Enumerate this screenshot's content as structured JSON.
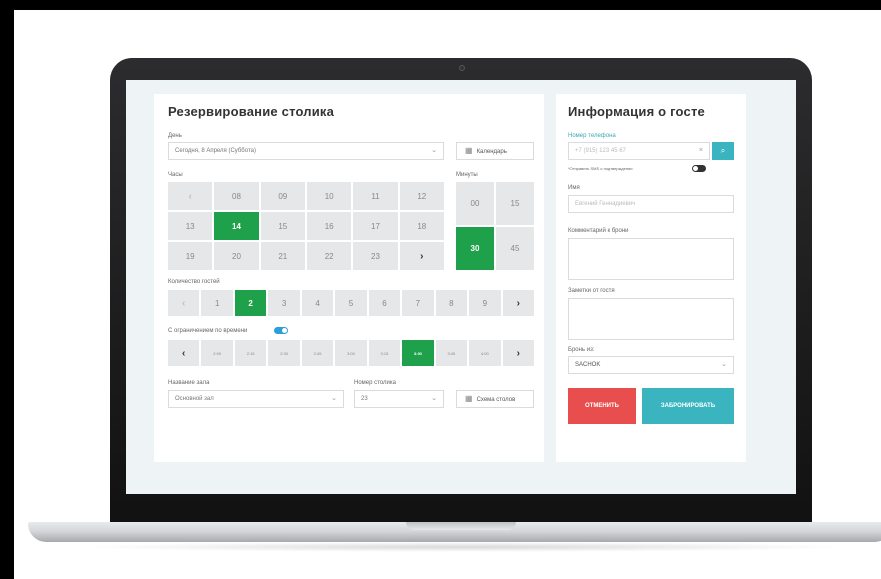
{
  "reservation": {
    "title": "Резервирование столика",
    "day_label": "День",
    "day_value": "Сегодня, 8 Апреля (Суббота)",
    "calendar_label": "Календарь",
    "hours_label": "Часы",
    "minutes_label": "Минуты",
    "hours": [
      [
        "‹",
        "08",
        "09",
        "10",
        "11",
        "12"
      ],
      [
        "13",
        "14",
        "15",
        "16",
        "17",
        "18"
      ],
      [
        "19",
        "20",
        "21",
        "22",
        "23",
        "›"
      ]
    ],
    "selected_hour": "14",
    "minutes": [
      "00",
      "15",
      "30",
      "45"
    ],
    "selected_minute": "30",
    "guests_label": "Количество гостей",
    "guests": [
      "‹",
      "1",
      "2",
      "3",
      "4",
      "5",
      "6",
      "7",
      "8",
      "9",
      "›"
    ],
    "selected_guests": "2",
    "time_limit_label": "С ограничением по времени",
    "durations": [
      "‹",
      "2:00",
      "2:15",
      "2:30",
      "2:45",
      "3:00",
      "3:15",
      "3:30",
      "3:45",
      "4:00",
      "›"
    ],
    "selected_duration": "3:30",
    "hall_label": "Название зала",
    "hall_value": "Основной зал",
    "table_label": "Номер столика",
    "table_value": "23",
    "scheme_label": "Схема столов"
  },
  "guest": {
    "title": "Информация о госте",
    "phone_label": "Номер телефона",
    "phone_placeholder": "+7 (915) 123 45 67",
    "sms_label": "*Отправить SMS о подтверждении",
    "name_label": "Имя",
    "name_placeholder": "Евгений Геннадиевич",
    "comment_label": "Комментарий к брони",
    "notes_label": "Заметки от гостя",
    "source_label": "Бронь из:",
    "source_value": "SACHOK",
    "cancel_label": "ОТМЕНИТЬ",
    "book_label": "ЗАБРОНИРОВАТЬ"
  },
  "colors": {
    "accent_green": "#1fa14b",
    "accent_teal": "#3ab5c0",
    "cancel_red": "#e84e4e",
    "toggle_blue": "#2a9fd8"
  }
}
